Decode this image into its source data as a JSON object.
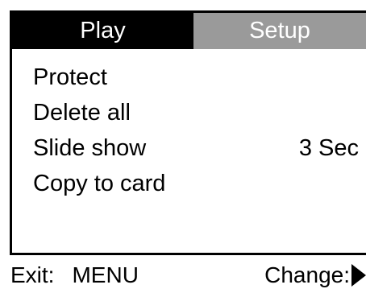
{
  "tabs": {
    "play": "Play",
    "setup": "Setup"
  },
  "menu": {
    "items": [
      {
        "label": "Protect",
        "value": ""
      },
      {
        "label": "Delete all",
        "value": ""
      },
      {
        "label": "Slide show",
        "value": "3 Sec"
      },
      {
        "label": "Copy to card",
        "value": ""
      }
    ]
  },
  "footer": {
    "exit_label": "Exit:",
    "exit_key": "MENU",
    "change_label": "Change:",
    "change_icon": "play-right-triangle"
  },
  "colors": {
    "active_tab": "#000000",
    "inactive_tab": "#9a9a9a",
    "text": "#000000",
    "background": "#ffffff"
  }
}
